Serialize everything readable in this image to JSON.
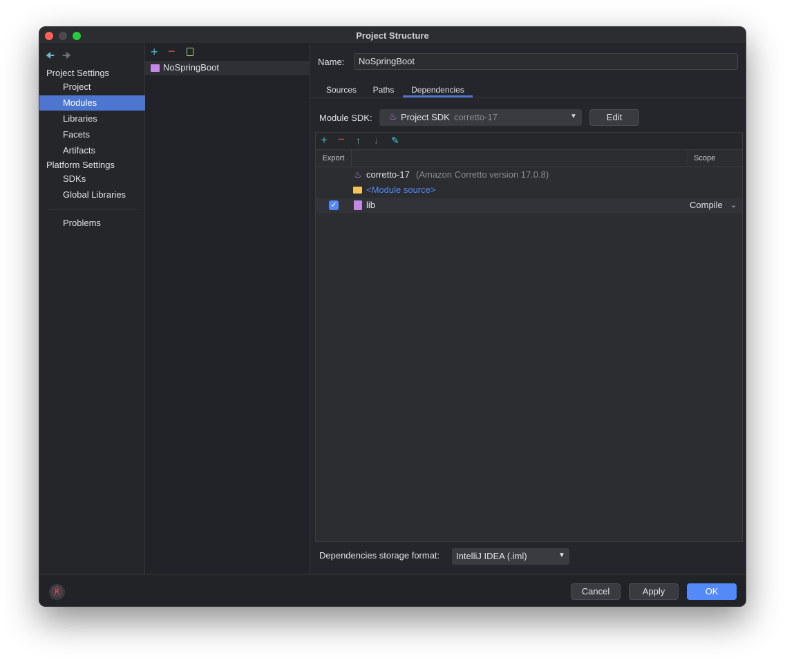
{
  "window": {
    "title": "Project Structure"
  },
  "sidebar": {
    "section1": "Project Settings",
    "items1": [
      "Project",
      "Modules",
      "Libraries",
      "Facets",
      "Artifacts"
    ],
    "section2": "Platform Settings",
    "items2": [
      "SDKs",
      "Global Libraries"
    ],
    "problems": "Problems",
    "selected": "Modules"
  },
  "modules": {
    "items": [
      "NoSpringBoot"
    ]
  },
  "detail": {
    "name_label": "Name:",
    "name_value": "NoSpringBoot",
    "tabs": [
      "Sources",
      "Paths",
      "Dependencies"
    ],
    "active_tab": "Dependencies",
    "sdk_label": "Module SDK:",
    "sdk_value": "Project SDK",
    "sdk_hint": "corretto-17",
    "edit": "Edit",
    "columns": {
      "export": "Export",
      "scope": "Scope"
    },
    "rows": [
      {
        "name": "corretto-17",
        "hint": "(Amazon Corretto version 17.0.8)"
      },
      {
        "name": "<Module source>"
      },
      {
        "name": "lib",
        "scope": "Compile",
        "export": true
      }
    ],
    "storage_label": "Dependencies storage format:",
    "storage_value": "IntelliJ IDEA (.iml)"
  },
  "buttons": {
    "cancel": "Cancel",
    "apply": "Apply",
    "ok": "OK"
  },
  "colors": {
    "accent": "#4c76cf",
    "ok": "#548af7",
    "link": "#548af7"
  }
}
